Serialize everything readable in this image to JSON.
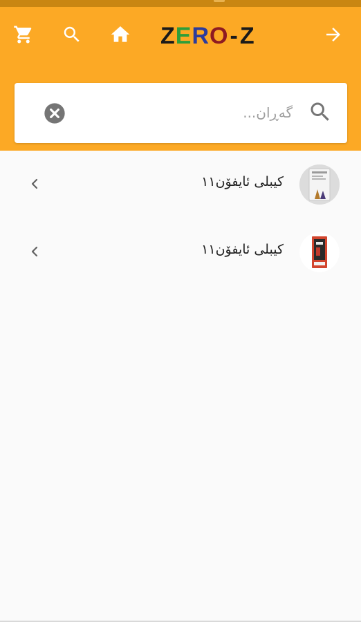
{
  "colors": {
    "appbar": "#fca925",
    "statusbar": "#c98612",
    "background": "#fafafa",
    "logo_dark": "#1a1a1a",
    "logo_green": "#2e9e3a",
    "logo_blue": "#2d3c9c",
    "logo_red": "#8e1b22"
  },
  "header": {
    "logo_text": {
      "z": "Z",
      "e": "E",
      "r": "R",
      "o": "O",
      "dash": "-",
      "z2": "Z"
    },
    "icons": [
      "cart-icon",
      "search-icon",
      "home-icon",
      "arrow-forward-icon"
    ]
  },
  "search": {
    "placeholder": "گەڕان...",
    "value": "",
    "icons": [
      "clear-icon",
      "search-icon"
    ]
  },
  "results": [
    {
      "label": "کیبلی ئایفۆن١١",
      "thumbnail": "product-thumbnail-1"
    },
    {
      "label": "کیبلی ئایفۆن١١",
      "thumbnail": "product-thumbnail-2"
    }
  ]
}
